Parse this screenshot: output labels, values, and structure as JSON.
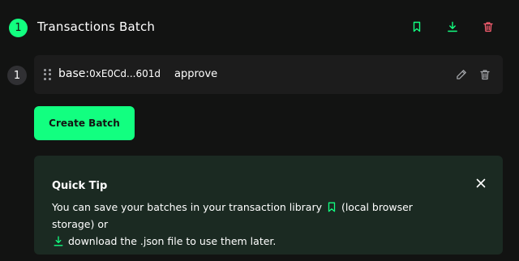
{
  "header": {
    "batch_count": "1",
    "title": "Transactions Batch",
    "actions": [
      {
        "name": "save-to-library",
        "icon": "bookmark-icon"
      },
      {
        "name": "download-json",
        "icon": "download-icon"
      },
      {
        "name": "delete-batch",
        "icon": "trash-icon"
      }
    ]
  },
  "transaction": {
    "index": "1",
    "chain_prefix": "base:",
    "address": "0xE0Cd...601d",
    "method": "approve",
    "actions": [
      {
        "name": "edit",
        "icon": "pencil-icon"
      },
      {
        "name": "delete",
        "icon": "trash-icon"
      }
    ]
  },
  "create_button_label": "Create Batch",
  "tip": {
    "title": "Quick Tip",
    "text_part1": "You can save your batches in your transaction library",
    "text_part2": "(local browser storage) or",
    "text_part3": "download the .json file to use them later."
  },
  "colors": {
    "background": "#121312",
    "accent": "#12ff80",
    "danger": "#ff5f72",
    "card": "#1c1c1c",
    "tip_background": "#1b2a22"
  }
}
